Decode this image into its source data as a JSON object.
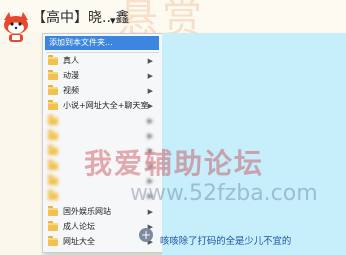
{
  "page": {
    "title": "【高中】晓...鑫",
    "decorative_text": "悬赏"
  },
  "menu": {
    "add_label": "添加到本文件夹...",
    "items": [
      {
        "label": "真人"
      },
      {
        "label": "动漫"
      },
      {
        "label": "视频"
      },
      {
        "label": "小说+网址大全+聊天室"
      },
      {
        "label": ""
      },
      {
        "label": ""
      },
      {
        "label": ""
      },
      {
        "label": ""
      },
      {
        "label": ""
      },
      {
        "label": ""
      },
      {
        "label": "国外娱乐网站"
      },
      {
        "label": "成人论坛"
      },
      {
        "label": "网址大全"
      }
    ]
  },
  "watermark": {
    "cn": "我爱辅助论坛",
    "url": "www.52fzba.com"
  },
  "caption": "咳咳除了打码的全是少儿不宜的",
  "colors": {
    "menu_highlight": "#3c86e0",
    "content_bg": "#c6eefb",
    "caption_text": "#2253a6"
  },
  "icons": [
    "fox-icon",
    "folder-icon",
    "chevron-right-icon",
    "zoom-icon"
  ]
}
